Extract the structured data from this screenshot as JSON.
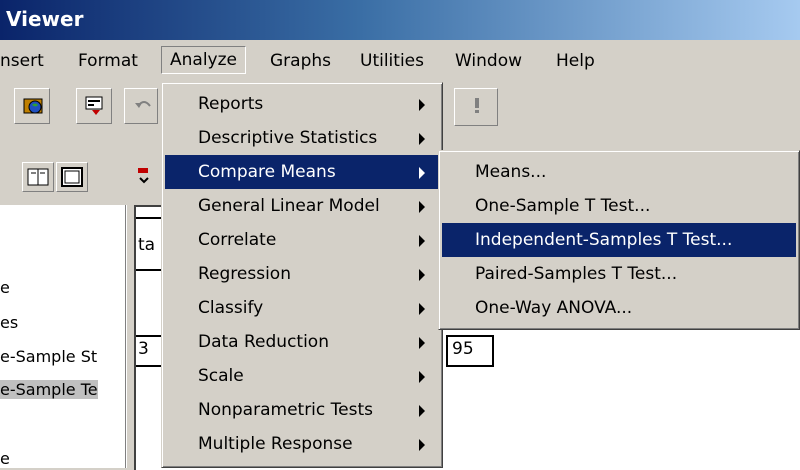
{
  "window": {
    "title": "Viewer"
  },
  "menubar": {
    "items": [
      "nsert",
      "Format",
      "Analyze",
      "Graphs",
      "Utilities",
      "Window",
      "Help"
    ]
  },
  "toolbar": {
    "icons": [
      "open-data-icon",
      "dialog-recall-icon",
      "undo-icon",
      "info-icon",
      "book-icon",
      "window-icon",
      "pivot-icon"
    ]
  },
  "outline": {
    "rows": [
      "e",
      "es",
      "e-Sample St",
      "e-Sample Te",
      "e"
    ]
  },
  "content": {
    "cell_fragment": "ta",
    "value_left": "3",
    "value_right": "95"
  },
  "analyze_menu": {
    "items": [
      {
        "label": "Reports",
        "submenu": true
      },
      {
        "label": "Descriptive Statistics",
        "submenu": true
      },
      {
        "label": "Compare Means",
        "submenu": true,
        "highlighted": true
      },
      {
        "label": "General Linear Model",
        "submenu": true
      },
      {
        "label": "Correlate",
        "submenu": true
      },
      {
        "label": "Regression",
        "submenu": true
      },
      {
        "label": "Classify",
        "submenu": true
      },
      {
        "label": "Data Reduction",
        "submenu": true
      },
      {
        "label": "Scale",
        "submenu": true
      },
      {
        "label": "Nonparametric Tests",
        "submenu": true
      },
      {
        "label": "Multiple Response",
        "submenu": true
      }
    ]
  },
  "compare_means_menu": {
    "items": [
      {
        "label": "Means..."
      },
      {
        "label": "One-Sample T Test..."
      },
      {
        "label": "Independent-Samples T Test...",
        "highlighted": true
      },
      {
        "label": "Paired-Samples T Test..."
      },
      {
        "label": "One-Way ANOVA..."
      }
    ]
  },
  "colors": {
    "highlight": "#0a246a",
    "face": "#d4d0c8"
  }
}
